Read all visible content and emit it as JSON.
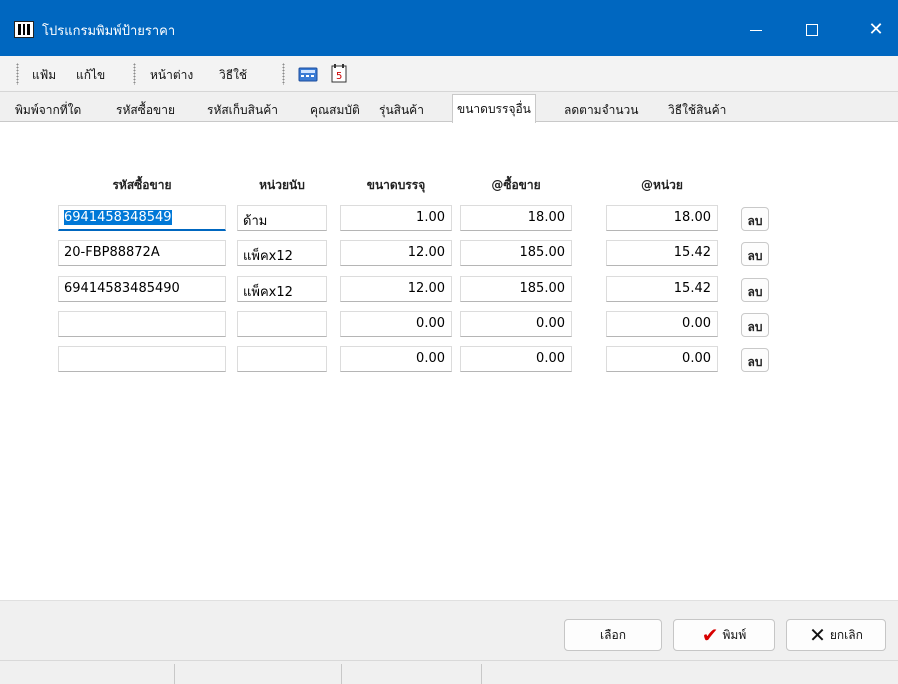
{
  "window": {
    "title": "โปรแกรมพิมพ์ป้ายราคา",
    "minimize_glyph": "—",
    "close_glyph": "✕"
  },
  "menu": {
    "file": "แฟ้ม",
    "edit": "แก้ไข",
    "window": "หน้าต่าง",
    "help": "วิธีใช้"
  },
  "toolbar": {
    "icons": [
      "calculator-icon",
      "calendar-icon"
    ]
  },
  "tabs": [
    {
      "label": "พิมพ์จากที่ใด"
    },
    {
      "label": "รหัสซื้อขาย"
    },
    {
      "label": "รหัสเก็บสินค้า"
    },
    {
      "label": "คุณสมบัติ"
    },
    {
      "label": "รุ่นสินค้า"
    },
    {
      "label": "ขนาดบรรจุอื่น",
      "active": true
    },
    {
      "label": "ลดตามจำนวน"
    },
    {
      "label": "วิธีใช้สินค้า"
    }
  ],
  "table": {
    "headers": {
      "code": "รหัสซื้อขาย",
      "unit": "หน่วยนับ",
      "pack": "ขนาดบรรจุ",
      "price": "@ซื้อขาย",
      "per_unit": "@หน่วย"
    },
    "delete_label": "ลบ",
    "rows": [
      {
        "code": "6941458348549",
        "unit": "ด้าม",
        "pack": "1.00",
        "price": "18.00",
        "per_unit": "18.00"
      },
      {
        "code": "20-FBP88872A",
        "unit": "แพ็คx12",
        "pack": "12.00",
        "price": "185.00",
        "per_unit": "15.42"
      },
      {
        "code": "69414583485490",
        "unit": "แพ็คx12",
        "pack": "12.00",
        "price": "185.00",
        "per_unit": "15.42"
      },
      {
        "code": "",
        "unit": "",
        "pack": "0.00",
        "price": "0.00",
        "per_unit": "0.00"
      },
      {
        "code": "",
        "unit": "",
        "pack": "0.00",
        "price": "0.00",
        "per_unit": "0.00"
      }
    ]
  },
  "buttons": {
    "select": "เลือก",
    "print": "พิมพ์",
    "cancel": "ยกเลิก",
    "print_icon_glyph": "✔",
    "cancel_icon_glyph": "✕"
  },
  "colors": {
    "titlebar": "#0067c0",
    "selection": "#0078d7",
    "print_check": "#d80000"
  }
}
